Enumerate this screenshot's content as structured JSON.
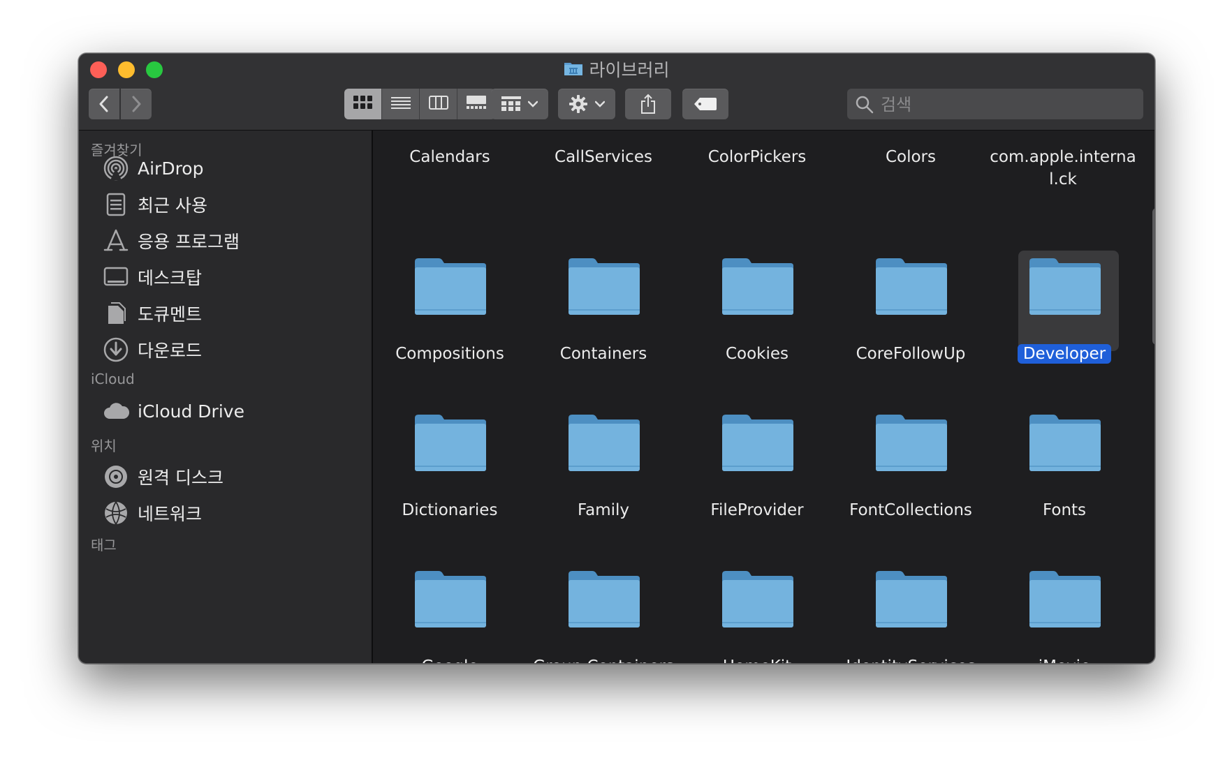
{
  "window": {
    "title": "라이브러리",
    "title_icon": "library-folder-icon"
  },
  "toolbar": {
    "back_icon": "chevron-left-icon",
    "forward_icon": "chevron-right-icon",
    "view_modes": [
      "icon-view-icon",
      "list-view-icon",
      "column-view-icon",
      "gallery-view-icon"
    ],
    "active_view": "icon-view-icon",
    "group_icon": "group-grid-icon",
    "action_icon": "gear-icon",
    "share_icon": "share-icon",
    "tag_icon": "tag-icon",
    "search_placeholder": "검색"
  },
  "sidebar": {
    "favorites_header": "즐겨찾기",
    "favorites": [
      {
        "label": "AirDrop",
        "icon": "airdrop-icon"
      },
      {
        "label": "최근 사용",
        "icon": "recents-icon"
      },
      {
        "label": "응용 프로그램",
        "icon": "applications-icon"
      },
      {
        "label": "데스크탑",
        "icon": "desktop-icon"
      },
      {
        "label": "도큐멘트",
        "icon": "documents-icon"
      },
      {
        "label": "다운로드",
        "icon": "downloads-icon"
      }
    ],
    "icloud_header": "iCloud",
    "icloud": [
      {
        "label": "iCloud Drive",
        "icon": "cloud-icon"
      }
    ],
    "locations_header": "위치",
    "locations": [
      {
        "label": "원격 디스크",
        "icon": "disc-icon"
      },
      {
        "label": "네트워크",
        "icon": "network-globe-icon"
      }
    ],
    "tags_header": "태그"
  },
  "content": {
    "top_row_labels": [
      "Calendars",
      "CallServices",
      "ColorPickers",
      "Colors",
      "com.apple.interna l.ck"
    ],
    "folders": [
      {
        "label": "Compositions",
        "selected": false
      },
      {
        "label": "Containers",
        "selected": false
      },
      {
        "label": "Cookies",
        "selected": false
      },
      {
        "label": "CoreFollowUp",
        "selected": false
      },
      {
        "label": "Developer",
        "selected": true
      },
      {
        "label": "Dictionaries",
        "selected": false
      },
      {
        "label": "Family",
        "selected": false
      },
      {
        "label": "FileProvider",
        "selected": false
      },
      {
        "label": "FontCollections",
        "selected": false
      },
      {
        "label": "Fonts",
        "selected": false
      },
      {
        "label": "Google",
        "selected": false
      },
      {
        "label": "Group Containers",
        "selected": false
      },
      {
        "label": "HomeKit",
        "selected": false
      },
      {
        "label": "IdentityServices",
        "selected": false
      },
      {
        "label": "iMovie",
        "selected": false
      }
    ]
  },
  "colors": {
    "selection": "#1f5fd9",
    "folder": "#6aaed8",
    "close": "#fd5f57",
    "minimize": "#febc2e",
    "maximize": "#28c840"
  }
}
